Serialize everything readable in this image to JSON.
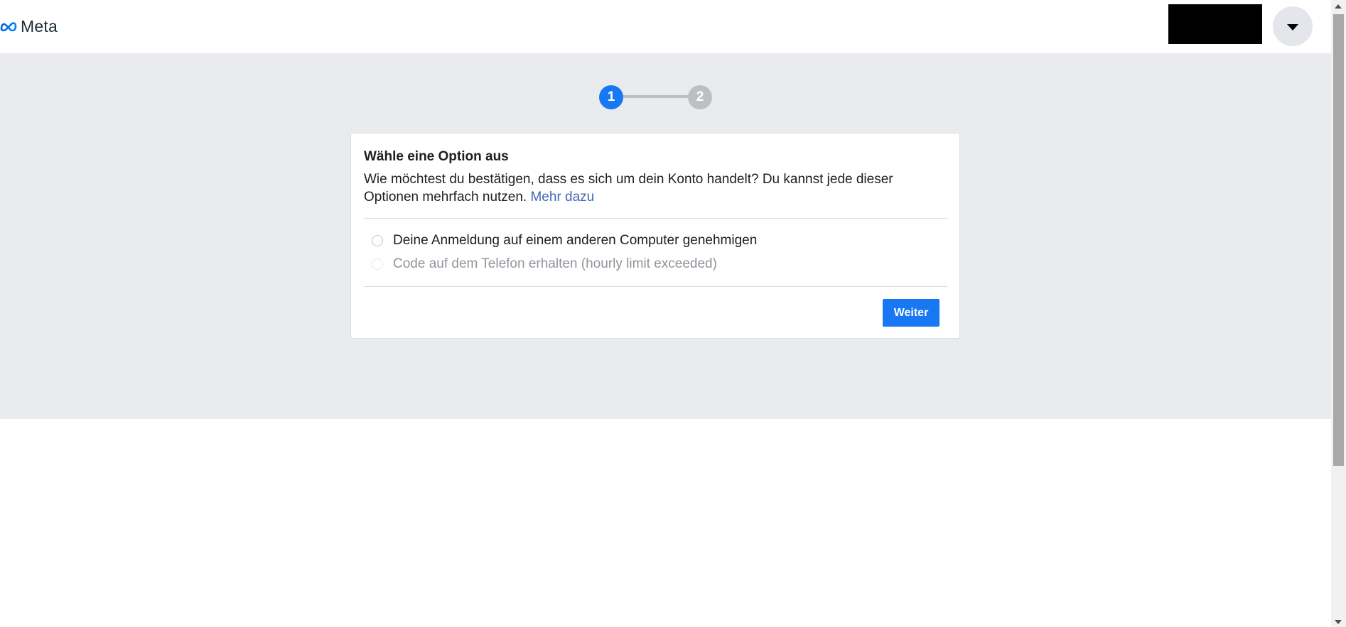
{
  "header": {
    "logo_text": "Meta",
    "logo_icon": "meta-infinity-icon",
    "menu_icon": "caret-down-icon"
  },
  "stepper": {
    "steps": [
      "1",
      "2"
    ],
    "active_step": 1
  },
  "card": {
    "title": "Wähle eine Option aus",
    "description": "Wie möchtest du bestätigen, dass es sich um dein Konto handelt? Du kannst jede dieser Optionen mehrfach nutzen.",
    "learn_more": "Mehr dazu",
    "options": [
      {
        "label": "Deine Anmeldung auf einem anderen Computer genehmigen",
        "enabled": true
      },
      {
        "label": "Code auf dem Telefon erhalten (hourly limit exceeded)",
        "enabled": false
      }
    ],
    "continue_label": "Weiter"
  },
  "colors": {
    "accent": "#1877f2",
    "background_grey": "#e9ebee",
    "link": "#4267b2",
    "disabled_text": "#90949c"
  }
}
